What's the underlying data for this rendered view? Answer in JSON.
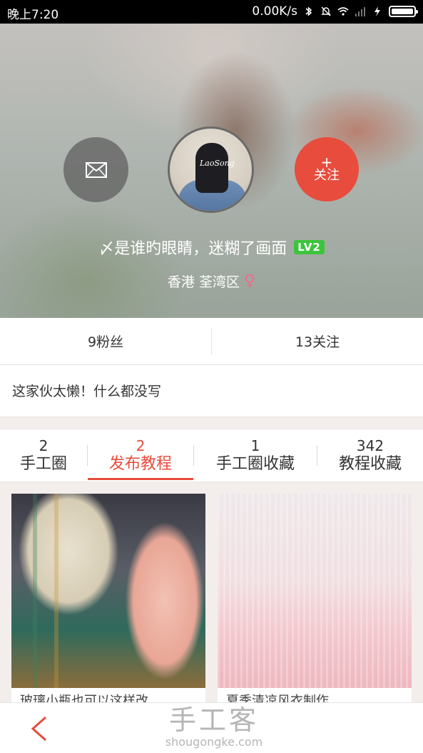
{
  "status_bar": {
    "time": "晚上7:20",
    "network_speed": "0.00K/s",
    "icons": [
      "bluetooth-icon",
      "mute-bell-icon",
      "wifi-icon",
      "signal-icon",
      "charging-icon",
      "battery-icon"
    ],
    "battery_level": 1.0
  },
  "profile": {
    "name": "〆是谁旳眼睛，迷糊了画面",
    "level_badge": "LV2",
    "location": "香港  荃湾区",
    "gender_symbol": "♀",
    "avatar_text": "LaoSong",
    "follow_plus": "+",
    "follow_label": "关注"
  },
  "stats": {
    "fans": "9粉丝",
    "following": "13关注"
  },
  "bio": "这家伙太懒！什么都没写",
  "tabs": [
    {
      "count": "2",
      "label": "手工圈"
    },
    {
      "count": "2",
      "label": "发布教程"
    },
    {
      "count": "1",
      "label": "手工圈收藏"
    },
    {
      "count": "342",
      "label": "教程收藏"
    }
  ],
  "active_tab": 1,
  "cards": [
    {
      "title": "玻璃小瓶也可以这样改"
    },
    {
      "title": "夏季清凉风衣制作"
    }
  ],
  "watermark": {
    "brand": "手工客",
    "domain": "shougongke.com"
  },
  "colors": {
    "accent": "#e84c3d",
    "level_badge": "#3cc43c",
    "gender": "#f26b8a"
  }
}
